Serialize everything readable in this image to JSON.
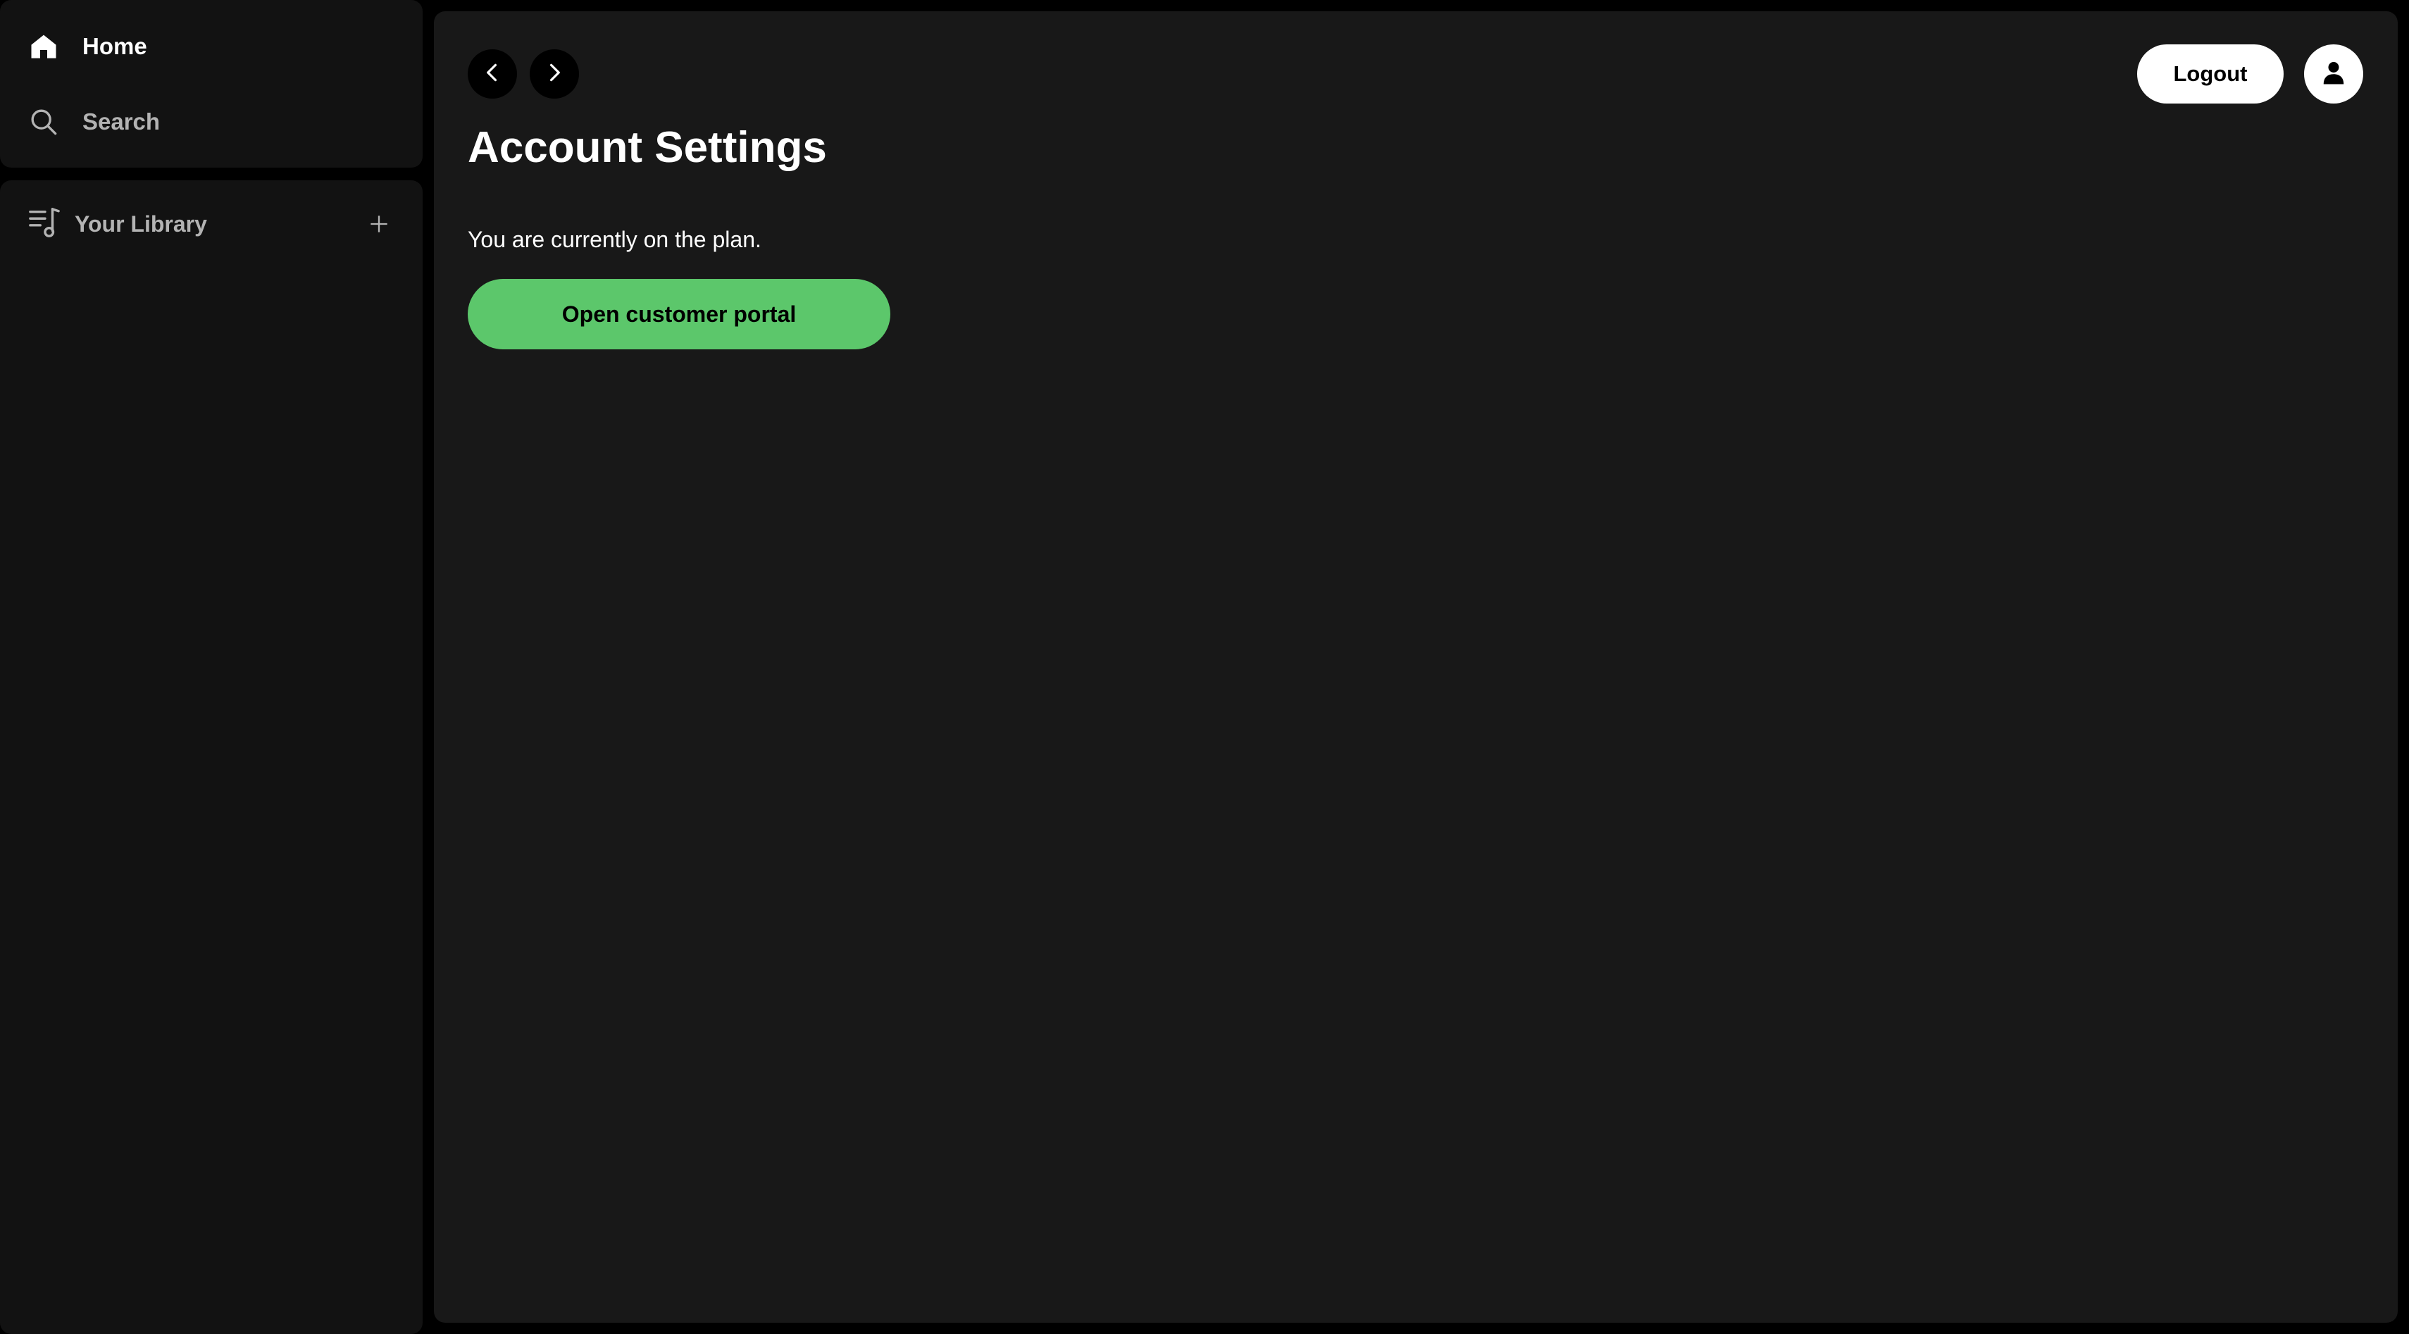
{
  "sidebar": {
    "nav": [
      {
        "label": "Home",
        "icon": "home-icon"
      },
      {
        "label": "Search",
        "icon": "search-icon"
      }
    ],
    "library": {
      "label": "Your Library",
      "icon": "library-icon",
      "add_icon": "plus-icon"
    }
  },
  "header": {
    "back_icon": "chevron-left-icon",
    "forward_icon": "chevron-right-icon",
    "logout_label": "Logout",
    "avatar_icon": "user-icon"
  },
  "main": {
    "title": "Account Settings",
    "plan_text": "You are currently on the plan.",
    "portal_button_label": "Open customer portal"
  },
  "colors": {
    "app_background": "#000000",
    "panel_background": "#121212",
    "main_background": "#181818",
    "accent_green": "#5cc76b",
    "text_primary": "#ffffff",
    "text_muted": "#b3b3b3"
  }
}
